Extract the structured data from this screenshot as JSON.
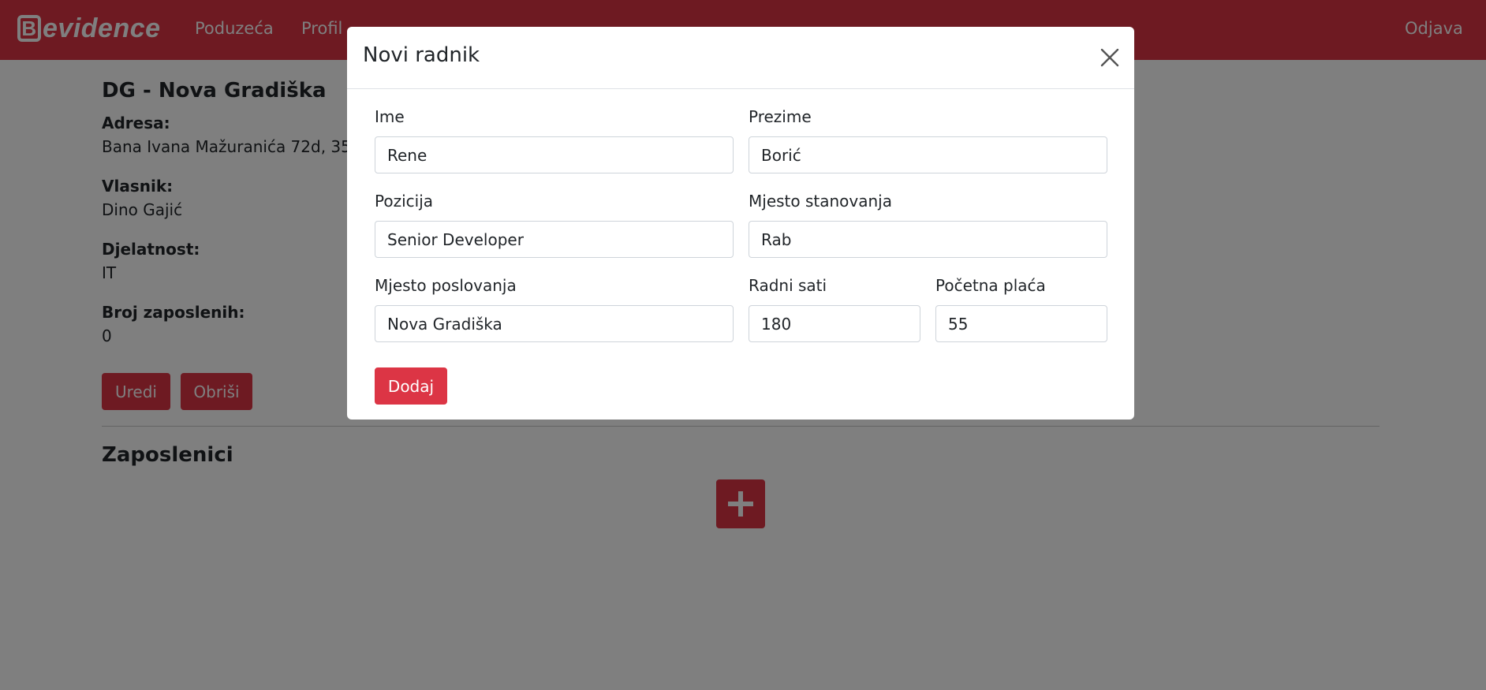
{
  "navbar": {
    "brand_letter": "B",
    "brand_rest": "evidence",
    "links": [
      "Poduzeća",
      "Profil"
    ],
    "logout": "Odjava"
  },
  "company": {
    "title": "DG - Nova Gradiška",
    "fields": [
      {
        "label": "Adresa:",
        "value": "Bana Ivana Mažuranića 72d, 35"
      },
      {
        "label": "Vlasnik:",
        "value": "Dino Gajić"
      },
      {
        "label": "Djelatnost:",
        "value": "IT"
      },
      {
        "label": "Broj zaposlenih:",
        "value": "0"
      }
    ],
    "edit_label": "Uredi",
    "delete_label": "Obriši"
  },
  "employees": {
    "title": "Zaposlenici",
    "add_icon": "plus-icon"
  },
  "modal": {
    "title": "Novi radnik",
    "close_icon": "close-icon",
    "fields": {
      "ime": {
        "label": "Ime",
        "value": "Rene"
      },
      "prezime": {
        "label": "Prezime",
        "value": "Borić"
      },
      "pozicija": {
        "label": "Pozicija",
        "value": "Senior Developer"
      },
      "mjesto_stanovanja": {
        "label": "Mjesto stanovanja",
        "value": "Rab"
      },
      "mjesto_poslovanja": {
        "label": "Mjesto poslovanja",
        "value": "Nova Gradiška"
      },
      "radni_sati": {
        "label": "Radni sati",
        "value": "180"
      },
      "pocetna_placa": {
        "label": "Početna plaća",
        "value": "55"
      }
    },
    "submit_label": "Dodaj"
  },
  "colors": {
    "primary": "#dc3545",
    "backdrop": "rgba(0,0,0,0.5)"
  }
}
